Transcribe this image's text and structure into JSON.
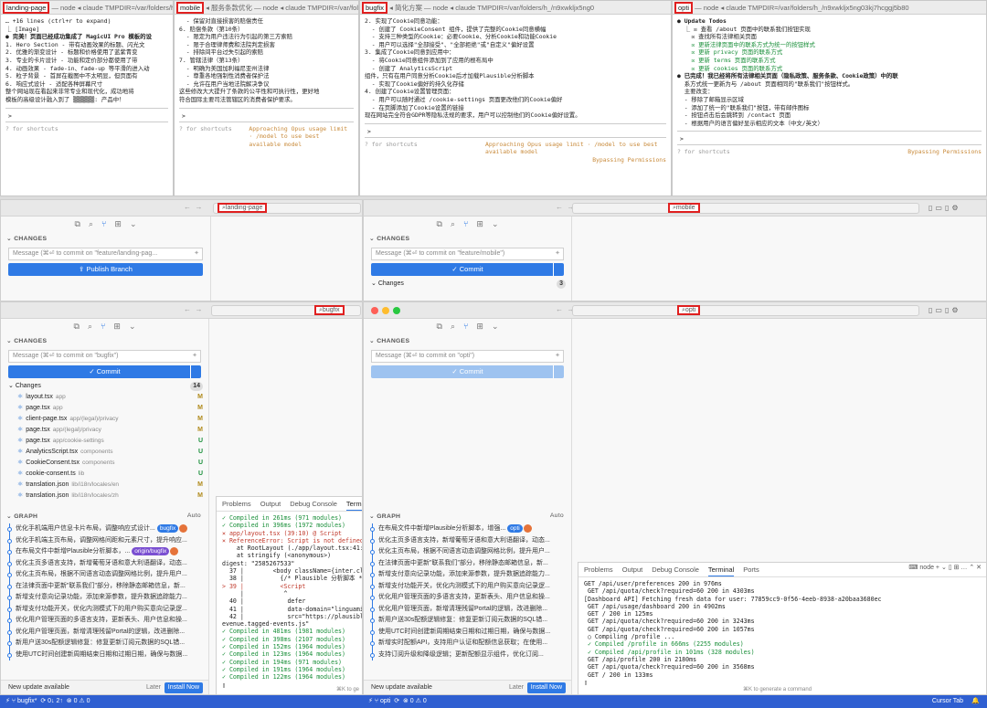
{
  "terminals": [
    {
      "title_highlight": "landing-page",
      "title_rest": " — node ◂ claude TMPDIR=/var/folders/h_/n9xwkljx5ng03kj7hcgg",
      "lines": [
        "… +16 lines (ctrl+r to expand)",
        "",
        "",
        "⎿ [Image]",
        "",
        "● 完美！页面已经成功集成了 MagicUI Pro 模板的设",
        "",
        "1. Hero Section - 带有动画效果的标题、闪光文",
        "2. 优雅的渐变设计 - 标题和价格使用了蓝紫青变",
        "3. 专业的卡片设计 - 功能和定价部分都使用了带",
        "4. 动画效果 - fade-in、fade-up 等平滑的进入动",
        "5. 粒子背景 - 首屏在截图中不太明显，但页面有",
        "6. 响应式设计 - 适配各种屏幕尺寸",
        "",
        "整个网站现在看起来非常专业和现代化，成功地将",
        "模板的高级设计融入到了 ▒▒▒▒▒▒: 产品中！"
      ],
      "prompt": ">",
      "footer_left": "? for shortcuts",
      "footer_right": ""
    },
    {
      "title_highlight": "mobile",
      "title_rest": " ◂ 服务条款优化 — node ◂ claude TMPDIR=/var/folders",
      "lines": [
        "  - 保留对直接损害的赔偿责任",
        "6. 赔偿条款（第10条）",
        "  - 限定为用户违法行为引起的第三方索赔",
        "  - 限于合理律师费和法院判定损害",
        "  - 排除间平台过失引起的索赔",
        "7. 管辖法律（第13条）",
        "  - 明确为美国加利福尼亚州法律",
        "  - 尊重各地强制性消费者保护法",
        "  - 允许在用户当地法院解决争议",
        "",
        "这些修改大大提升了条款的公平性和可执行性，更好地",
        "符合国际主要司法管辖区的消费者保护要求。"
      ],
      "prompt": ">",
      "footer_left": "? for shortcuts",
      "footer_right": "Approaching Opus usage limit · /model to use best available model"
    },
    {
      "title_highlight": "bugfix",
      "title_rest": " ◂ 简化方案 — node ◂ claude TMPDIR=/var/folders/h_/n9xwkljx5ng0",
      "lines": [
        "2. 实现了Cookie同意功能：",
        "  - 创建了 CookieConsent 组件，提供了完整的Cookie同意横幅",
        "  - 支持三种类型的Cookie：必要Cookie、分析Cookie和功能Cookie",
        "  - 用户可以选择\"全部接受\"、\"全部拒绝\"或\"自定义\"偏好设置",
        "3. 集成了Cookie同意到应用中：",
        "  - 将Cookie同意组件添加到了应用的根布局中",
        "  - 创建了 AnalyticsScript",
        "组件，只有在用户同意分析Cookie后才加载Plausible分析脚本",
        "  - 实现了Cookie偏好的持久化存储",
        "4. 创建了Cookie设置管理页面：",
        "  - 用户可以随时通过 /cookie-settings 页面更改他们的Cookie偏好",
        "  - 在页脚添加了Cookie设置的链接",
        "",
        "现在网站完全符合GDPR等隐私法规的要求，用户可以控制他们的Cookie偏好设置。"
      ],
      "prompt": ">",
      "footer_left": "? for shortcuts",
      "footer_right": "Approaching Opus usage limit · /model to use best available model",
      "footer_right2": "Bypassing Permissions"
    },
    {
      "title_highlight": "opti",
      "title_rest": " — node ◂ claude TMPDIR=/var/folders/h_/n9xwkljx5ng03kj7hcggj5b80",
      "lines": [
        "● Update Todos",
        "  ⎿ ☒ 查看 /about 页面中的联系我们按钮实现",
        "    ☒ 查找所有法律相关页面",
        "    ☒ 更新法律页面中的联系方式为统一的按钮样式",
        "    ☒ 更新 privacy 页面的联系方式",
        "    ☒ 更新 terms 页面的联系方式",
        "    ☒ 更新 cookies 页面的联系方式",
        "",
        "● 已完成！我已经将所有法律相关页面（隐私政策、服务条款、Cookie政策）中的联",
        "  系方式统一更新为与 /about 页面相同的\"联系我们\"按钮样式。",
        "",
        "  主要改变：",
        "  - 移除了邮箱显示区域",
        "  - 添加了统一的\"联系我们\"按钮，带有邮件图标",
        "  - 按钮点击后会跳转到 /contact 页面",
        "  - 根据用户的语言偏好显示相应的文本（中文/英文）"
      ],
      "prompt": ">",
      "footer_left": "? for shortcuts",
      "footer_right": "Bypassing Permissions"
    }
  ],
  "vscode": [
    {
      "search": "landing-page",
      "changes_label": "CHANGES",
      "message_placeholder": "Message (⌘⏎ to commit on \"feature/landing-pag...",
      "button_label": "⇪ Publish Branch"
    },
    {
      "search": "mobile",
      "changes_label": "CHANGES",
      "message_placeholder": "Message (⌘⏎ to commit on \"feature/mobile\")",
      "button_label": "✓ Commit",
      "changes_group": "Changes",
      "changes_count": "3"
    },
    {
      "search": "bugfix",
      "changes_label": "CHANGES",
      "message_placeholder": "Message (⌘⏎ to commit on \"bugfix\")",
      "button_label": "✓ Commit",
      "changes_group": "Changes",
      "changes_count": "14",
      "files": [
        {
          "name": "layout.tsx",
          "path": "app",
          "status": "M"
        },
        {
          "name": "page.tsx",
          "path": "app",
          "status": "M"
        },
        {
          "name": "client-page.tsx",
          "path": "app/(legal)/privacy",
          "status": "M"
        },
        {
          "name": "page.tsx",
          "path": "app/(legal)/privacy",
          "status": "M"
        },
        {
          "name": "page.tsx",
          "path": "app/cookie-settings",
          "status": "U"
        },
        {
          "name": "AnalyticsScript.tsx",
          "path": "components",
          "status": "U"
        },
        {
          "name": "CookieConsent.tsx",
          "path": "components",
          "status": "U"
        },
        {
          "name": "cookie-consent.ts",
          "path": "lib",
          "status": "U"
        },
        {
          "name": "translation.json",
          "path": "lib/i18n/locales/en",
          "status": "M"
        },
        {
          "name": "translation.json",
          "path": "lib/i18n/locales/zh",
          "status": "M"
        }
      ],
      "graph_label": "GRAPH",
      "graph_auto": "Auto",
      "graph": [
        {
          "text": "优化手机端用户信息卡片布局，调整响应式设计...",
          "tag": "bugfix",
          "tag2": ""
        },
        {
          "text": "优化手机端主页布局，调整网格间距和元素尺寸，提升响应...",
          "tag": "",
          "tag2": ""
        },
        {
          "text": "在布局文件中新增Plausible分析脚本，...",
          "tag": "origin/bugfix",
          "tag2": ""
        },
        {
          "text": "优化主页多语言支持，新增葡萄牙语和意大利语翻译，动态...",
          "tag": "",
          "tag2": ""
        },
        {
          "text": "优化主页布局，根据不同语言动态调整网格比例，提升用户...",
          "tag": "",
          "tag2": ""
        },
        {
          "text": "在法律页面中更新\"联系我们\"部分，移除静态邮箱信息，新...",
          "tag": "",
          "tag2": ""
        },
        {
          "text": "新增支付意向记录功能，添加来源参数，提升数据追踪能力...",
          "tag": "",
          "tag2": ""
        },
        {
          "text": "新增支付功能开关，优化内测模式下的用户购买意向记录逻...",
          "tag": "",
          "tag2": ""
        },
        {
          "text": "优化用户管理页面的多语言支持，更新表头、用户信息和操...",
          "tag": "",
          "tag2": ""
        },
        {
          "text": "优化用户管理页面，新增清理残留Portal的逻辑，改进删除...",
          "tag": "",
          "tag2": ""
        },
        {
          "text": "新用户送30s配额逻辑修复：修复更新订阅元数据的SQL错...",
          "tag": "",
          "tag2": ""
        },
        {
          "text": "使用UTC时间创建新周期结束日期和过期日期，确保与数据...",
          "tag": "",
          "tag2": ""
        }
      ],
      "update_text": "New update available",
      "later": "Later",
      "install": "Install Now"
    },
    {
      "search": "opti",
      "changes_label": "CHANGES",
      "message_placeholder": "Message (⌘⏎ to commit on \"opti\")",
      "button_label": "✓ Commit",
      "graph_label": "GRAPH",
      "graph_auto": "Auto",
      "graph": [
        {
          "text": "在布局文件中新增Plausible分析脚本，增强...",
          "tag": "opti",
          "tag2": ""
        },
        {
          "text": "优化主页多语言支持，新增葡萄牙语和意大利语翻译，动态...",
          "tag": "",
          "tag2": ""
        },
        {
          "text": "优化主页布局，根据不同语言动态调整网格比例，提升用户...",
          "tag": "",
          "tag2": ""
        },
        {
          "text": "在法律页面中更新\"联系我们\"部分，移除静态邮箱信息，新...",
          "tag": "",
          "tag2": ""
        },
        {
          "text": "新增支付意向记录功能，添加来源参数，提升数据追踪能力...",
          "tag": "",
          "tag2": ""
        },
        {
          "text": "新增支付功能开关，优化内测模式下的用户购买意向记录逻...",
          "tag": "",
          "tag2": ""
        },
        {
          "text": "优化用户管理页面的多语言支持，更新表头、用户信息和操...",
          "tag": "",
          "tag2": ""
        },
        {
          "text": "优化用户管理页面，新增清理残留Portal的逻辑，改进删除...",
          "tag": "",
          "tag2": ""
        },
        {
          "text": "新用户送30s配额逻辑修复：修复更新订阅元数据的SQL错...",
          "tag": "",
          "tag2": ""
        },
        {
          "text": "使用UTC时间创建新周期结束日期和过期日期，确保与数据...",
          "tag": "",
          "tag2": ""
        },
        {
          "text": "新增实时配额API，支持用户认证和配额信息获取；在使用...",
          "tag": "",
          "tag2": ""
        },
        {
          "text": "支持订阅升级和降级逻辑；更新配额显示组件，优化订阅...",
          "tag": "",
          "tag2": ""
        }
      ],
      "update_text": "New update available",
      "later": "Later",
      "install": "Install Now"
    }
  ],
  "panels": [
    {
      "tabs": [
        "Problems",
        "Output",
        "Debug Console",
        "Termi"
      ],
      "active": 3,
      "lines": [
        "✓ Compiled in 261ms (971 modules)",
        "✓ Compiled in 396ms (1972 modules)",
        "⨯ app/layout.tsx (39:10) @ Script",
        "⨯ ReferenceError: Script is not defined",
        "    at RootLayout (./app/layout.tsx:41:",
        "    at stringify (<anonymous>)",
        "digest: \"2585267533\"",
        "  37 |        <body className={inter.cla",
        "  38 |          {/* Plausible 分析脚本 *",
        "> 39 |          <Script",
        "     |           ^",
        "  40 |            defer",
        "  41 |            data-domain=\"linguamir",
        "  42 |            src=\"https://plausible",
        "evenue.tagged-events.js\"",
        "✓ Compiled in 481ms (1981 modules)",
        "✓ Compiled in 398ms (2107 modules)",
        "✓ Compiled in 152ms (1964 modules)",
        "✓ Compiled in 123ms (1964 modules)",
        "✓ Compiled in 194ms (971 modules)",
        "✓ Compiled in 191ms (1964 modules)",
        "✓ Compiled in 122ms (1964 modules)",
        "▯"
      ],
      "hint": "⌘K to ge"
    },
    {
      "tabs": [
        "Problems",
        "Output",
        "Debug Console",
        "Terminal",
        "Ports"
      ],
      "active": 3,
      "shell": "node",
      "lines": [
        "GET /api/user/preferences 200 in 976ms",
        " GET /api/quota/check?required=60 200 in 4303ms",
        "[Dashboard API] Fetching fresh data for user: 77859cc9-0f56-4eeb-8938-a20baa3680ec",
        " GET /api/usage/dashboard 200 in 4902ms",
        " GET / 200 in 125ms",
        " GET /api/quota/check?required=60 200 in 3243ms",
        " GET /api/quota/check?required=60 200 in 1057ms",
        " ○ Compiling /profile ...",
        " ✓ Compiled /profile in 666ms (2255 modules)",
        " ✓ Compiled /api/profile in 101ms (328 modules)",
        " GET /api/profile 200 in 2180ms",
        " GET /api/quota/check?required=60 200 in 3568ms",
        " GET / 200 in 133ms",
        "▯"
      ],
      "hint": "⌘K to generate a command"
    }
  ],
  "statusbars": [
    {
      "branch": "bugfix*",
      "sync": "⟳ 0↓ 2↑",
      "problems": "⊗ 0 ⚠ 0"
    },
    {
      "branch": "opti",
      "sync": "⟳",
      "problems": "⊗ 0 ⚠ 0",
      "right": "Cursor Tab"
    }
  ],
  "colors": {
    "accent": "#2f7ae5",
    "highlight_box": "#e02020",
    "statusbar": "#2f5fd1"
  }
}
